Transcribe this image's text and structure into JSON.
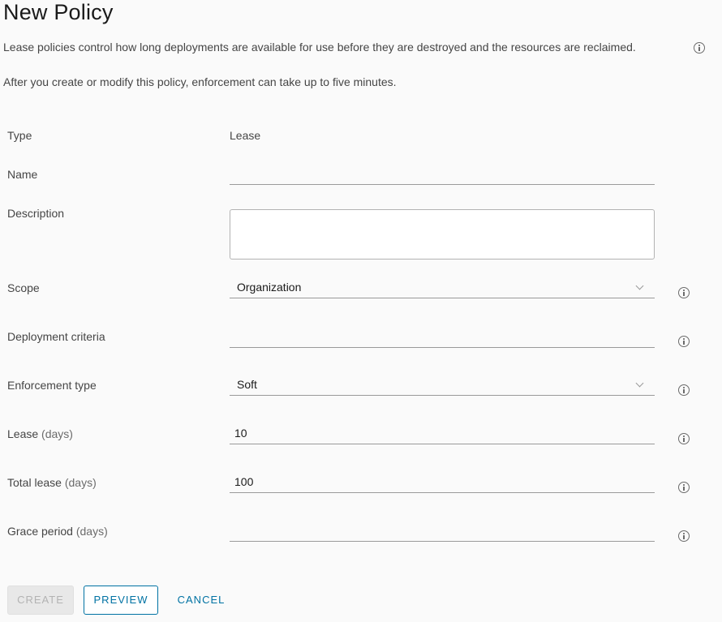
{
  "page": {
    "title": "New Policy",
    "description_1": "Lease policies control how long deployments are available for use before they are destroyed and the resources are reclaimed.",
    "description_2": "After you create or modify this policy, enforcement can take up to five minutes."
  },
  "form": {
    "type": {
      "label": "Type",
      "value": "Lease"
    },
    "name": {
      "label": "Name",
      "value": ""
    },
    "description": {
      "label": "Description",
      "value": ""
    },
    "scope": {
      "label": "Scope",
      "value": "Organization"
    },
    "deployment_criteria": {
      "label": "Deployment criteria",
      "value": ""
    },
    "enforcement_type": {
      "label": "Enforcement type",
      "value": "Soft"
    },
    "lease": {
      "label": "Lease",
      "unit": "(days)",
      "value": "10"
    },
    "total_lease": {
      "label": "Total lease",
      "unit": "(days)",
      "value": "100"
    },
    "grace_period": {
      "label": "Grace period",
      "unit": "(days)",
      "value": ""
    }
  },
  "buttons": {
    "create": "CREATE",
    "preview": "PREVIEW",
    "cancel": "CANCEL"
  },
  "icons": {
    "info": "info-circle-icon",
    "dropdown": "chevron-down-icon"
  },
  "colors": {
    "accent": "#0072a3",
    "background": "#fafafa",
    "disabled_button": "#e8e8e8"
  }
}
